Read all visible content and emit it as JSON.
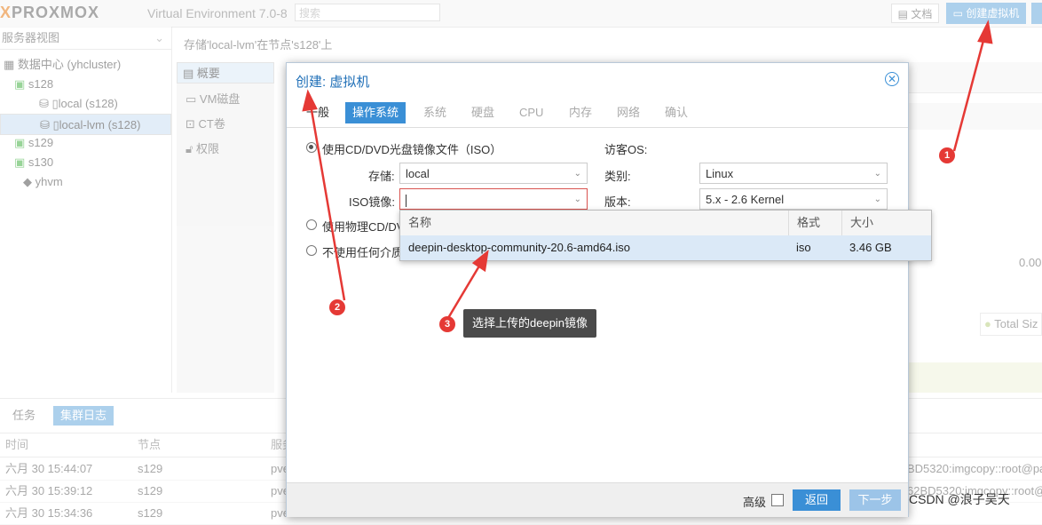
{
  "topbar": {
    "brand": "PROXMOX",
    "version": "Virtual Environment 7.0-8",
    "search_placeholder": "搜索",
    "docs_label": "文档",
    "create_vm_label": "创建虚拟机"
  },
  "tree": {
    "view_label": "服务器视图",
    "items": [
      {
        "label": "数据中心 (yhcluster)"
      },
      {
        "label": "s128"
      },
      {
        "label": "local (s128)"
      },
      {
        "label": "local-lvm (s128)"
      },
      {
        "label": "s129"
      },
      {
        "label": "s130"
      },
      {
        "label": "yhvm"
      }
    ]
  },
  "breadcrumb": "存储'local-lvm'在节点's128'上",
  "nav": {
    "items": [
      {
        "label": "概要"
      },
      {
        "label": "VM磁盘"
      },
      {
        "label": "CT卷"
      },
      {
        "label": "权限"
      }
    ]
  },
  "right_panel": {
    "value": "0.00",
    "legend": "Total Siz"
  },
  "tasks": {
    "tab_tasks": "任务",
    "tab_cluster_log": "集群日志",
    "columns": [
      "时间",
      "节点",
      "服务"
    ],
    "rows": [
      {
        "time": "六月 30 15:44:07",
        "node": "s129",
        "service": "pve",
        "msg": "BD5320:imgcopy::root@pa"
      },
      {
        "time": "六月 30 15:39:12",
        "node": "s129",
        "service": "pve",
        "msg": "62BD5320:imgcopy::root@"
      },
      {
        "time": "六月 30 15:34:36",
        "node": "s129",
        "service": "pve",
        "msg": ""
      }
    ]
  },
  "dialog": {
    "title": "创建: 虚拟机",
    "tabs": [
      "一般",
      "操作系统",
      "系统",
      "硬盘",
      "CPU",
      "内存",
      "网络",
      "确认"
    ],
    "active_tab": "操作系统",
    "radio_iso": "使用CD/DVD光盘镜像文件（ISO）",
    "storage_label": "存储:",
    "storage_value": "local",
    "iso_label": "ISO镜像:",
    "iso_value": "",
    "radio_physical": "使用物理CD/DV",
    "radio_none": "不使用任何介质",
    "guest_os_label": "访客OS:",
    "type_label": "类别:",
    "type_value": "Linux",
    "version_label": "版本:",
    "version_value": "5.x - 2.6 Kernel",
    "advanced_label": "高级",
    "back_label": "返回",
    "next_label": "下一步"
  },
  "iso_dropdown": {
    "columns": [
      "名称",
      "格式",
      "大小"
    ],
    "rows": [
      {
        "name": "deepin-desktop-community-20.6-amd64.iso",
        "format": "iso",
        "size": "3.46 GB"
      }
    ]
  },
  "annotations": {
    "badges": [
      "1",
      "2",
      "3"
    ],
    "callout": "选择上传的deepin镜像",
    "color": "#e53935"
  },
  "watermark": "CSDN @浪子吴天"
}
